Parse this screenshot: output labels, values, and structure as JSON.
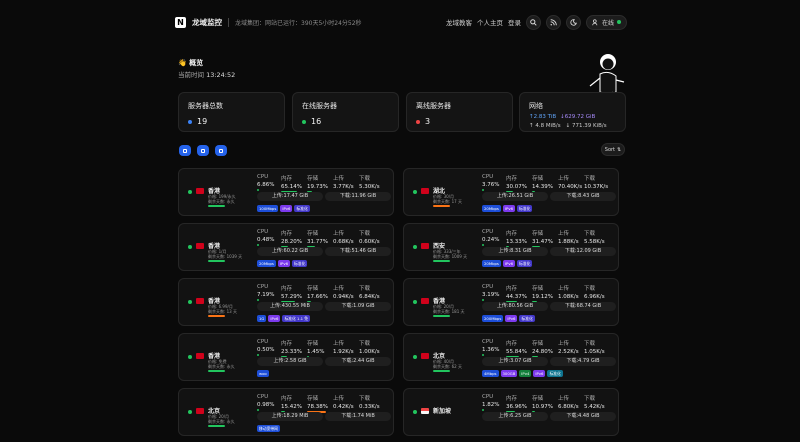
{
  "header": {
    "brand": "龙域监控",
    "uptime": "龙域集团：网站已运行：390天5小时24分52秒",
    "links": [
      "龙域教客",
      "个人主页",
      "登录"
    ],
    "online_label": "在线"
  },
  "overview": {
    "title": "👋 概览",
    "time_label": "当前时间",
    "time_value": "13:24:52"
  },
  "stats": {
    "total_label": "服务器总数",
    "total_value": "19",
    "online_label": "在线服务器",
    "online_value": "16",
    "offline_label": "离线服务器",
    "offline_value": "3",
    "network_label": "网络",
    "net_up": "↑2.83 TiB",
    "net_down": "↓629.72 GiB",
    "speed_up": "4.8 MiB/s",
    "speed_down": "771.39 KiB/s"
  },
  "sort_label": "Sort",
  "column_labels": [
    "CPU",
    "内存",
    "存储",
    "上传",
    "下载"
  ],
  "servers": [
    {
      "name": "香港",
      "price": "价格: 199/永久",
      "remain": "剩余天数: 永久",
      "cpu": "6.86%",
      "mem": "65.14%",
      "disk": "19.73%",
      "up": "3.77K/s",
      "down": "5.30K/s",
      "traffic_up": "上传:17.47 GiB",
      "traffic_down": "下载:11.96 GiB",
      "tags": [
        "100Mbps",
        "IPv6",
        "标准化"
      ],
      "flag": "cn",
      "bar_color": "#22c55e"
    },
    {
      "name": "湖北",
      "price": "价格: 30/月",
      "remain": "剩余天数: 17 天",
      "cpu": "3.76%",
      "mem": "30.07%",
      "disk": "14.39%",
      "up": "70.40K/s",
      "down": "10.37K/s",
      "traffic_up": "上传:26.51 GiB",
      "traffic_down": "下载:8.43 GiB",
      "tags": [
        "20Mbps",
        "IPv6",
        "标准化"
      ],
      "flag": "cn",
      "bar_color": "#f97316"
    },
    {
      "name": "香港",
      "price": "价格: 1/月",
      "remain": "剩余天数: 1039 天",
      "cpu": "0.48%",
      "mem": "28.20%",
      "disk": "31.77%",
      "up": "0.68K/s",
      "down": "0.60K/s",
      "traffic_up": "上传:60.22 GiB",
      "traffic_down": "下载:51.46 GiB",
      "tags": [
        "20Mbps",
        "IPv6",
        "标准化"
      ],
      "flag": "cn",
      "bar_color": "#22c55e"
    },
    {
      "name": "西安",
      "price": "价格: 333/三年",
      "remain": "剩余天数: 1009 天",
      "cpu": "0.24%",
      "mem": "13.33%",
      "disk": "31.47%",
      "up": "1.88K/s",
      "down": "5.58K/s",
      "traffic_up": "上传:8.31 GiB",
      "traffic_down": "下载:12.09 GiB",
      "tags": [
        "20Mbps",
        "IPv6",
        "标准化"
      ],
      "flag": "cn",
      "bar_color": "#22c55e"
    },
    {
      "name": "香港",
      "price": "价格: 6.99/月",
      "remain": "剩余天数: 13 天",
      "cpu": "7.19%",
      "mem": "57.29%",
      "disk": "17.66%",
      "up": "0.94K/s",
      "down": "6.84K/s",
      "traffic_up": "上传:430.55 MiB",
      "traffic_down": "下载:1.09 GiB",
      "tags": [
        "1G",
        "IPv6",
        "标准化 1.1 免"
      ],
      "flag": "cn",
      "bar_color": "#f97316"
    },
    {
      "name": "香港",
      "price": "价格: 20/月",
      "remain": "剩余天数: 181 天",
      "cpu": "3.19%",
      "mem": "44.37%",
      "disk": "19.12%",
      "up": "1.08K/s",
      "down": "6.96K/s",
      "traffic_up": "上传:80.56 GiB",
      "traffic_down": "下载:68.74 GiB",
      "tags": [
        "200Mbps",
        "IPv6",
        "标准化"
      ],
      "flag": "cn",
      "bar_color": "#22c55e"
    },
    {
      "name": "香港",
      "price": "价格: 免费",
      "remain": "剩余天数: 永久",
      "cpu": "0.50%",
      "mem": "23.33%",
      "disk": "1.45%",
      "up": "1.92K/s",
      "down": "1.00K/s",
      "traffic_up": "上传:2.58 GiB",
      "traffic_down": "下载:2.44 GiB",
      "tags": [
        "woo"
      ],
      "flag": "cn",
      "bar_color": "#22c55e"
    },
    {
      "name": "北京",
      "price": "价格: 40/月",
      "remain": "剩余天数: 62 天",
      "cpu": "1.36%",
      "mem": "55.84%",
      "disk": "24.80%",
      "up": "2.52K/s",
      "down": "1.05K/s",
      "traffic_up": "上传:3.07 GiB",
      "traffic_down": "下载:4.79 GiB",
      "tags": [
        "4Mbps",
        "300GB",
        "IPv4",
        "IPv6",
        "标准化"
      ],
      "flag": "cn",
      "bar_color": "#22c55e"
    },
    {
      "name": "北京",
      "price": "价格: 20/月",
      "remain": "剩余天数: 永久",
      "cpu": "0.98%",
      "mem": "15.42%",
      "disk": "78.38%",
      "up": "0.42K/s",
      "down": "0.33K/s",
      "traffic_up": "上传:18.29 MiB",
      "traffic_down": "下载:1.74 MiB",
      "tags": [
        "移动宽带网"
      ],
      "flag": "cn",
      "bar_color": "#22c55e"
    },
    {
      "name": "新加坡",
      "price": "",
      "remain": "",
      "cpu": "1.82%",
      "mem": "36.96%",
      "disk": "10.97%",
      "up": "6.80K/s",
      "down": "5.42K/s",
      "traffic_up": "上传:6.25 GiB",
      "traffic_down": "下载:4.48 GiB",
      "tags": [],
      "flag": "sg",
      "bar_color": ""
    }
  ],
  "colors": {
    "accent": "#2563eb",
    "online": "#22c55e",
    "offline": "#ef4444",
    "bg": "#0a0a0a",
    "card": "#121212"
  }
}
